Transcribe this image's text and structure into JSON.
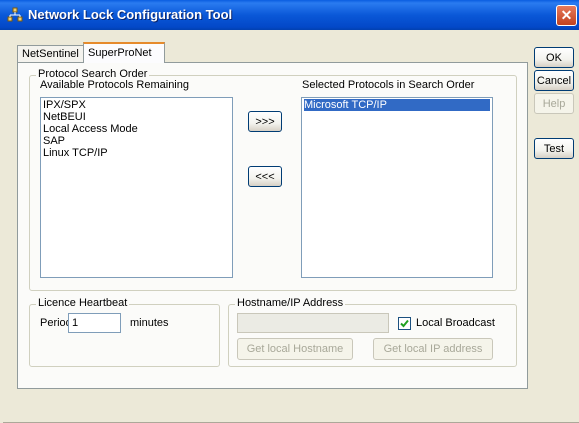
{
  "window": {
    "title": "Network Lock Configuration Tool",
    "close_glyph": "✕"
  },
  "tabs": [
    {
      "label": "NetSentinel",
      "active": false
    },
    {
      "label": "SuperProNet",
      "active": true
    }
  ],
  "protocol_group": {
    "legend": "Protocol Search Order",
    "available_label": "Available Protocols Remaining",
    "selected_label": "Selected Protocols in Search Order",
    "available": [
      "IPX/SPX",
      "NetBEUI",
      "Local Access Mode",
      "SAP",
      "Linux TCP/IP"
    ],
    "selected": [
      "Microsoft TCP/IP"
    ],
    "add_button": ">>>",
    "remove_button": "<<<"
  },
  "heartbeat_group": {
    "legend": "Licence Heartbeat",
    "period_label": "Period",
    "period_value": "1",
    "unit_label": "minutes"
  },
  "hostname_group": {
    "legend": "Hostname/IP Address",
    "hostname_value": "",
    "broadcast_label": "Local Broadcast",
    "broadcast_checked": true,
    "get_hostname_button": "Get local Hostname",
    "get_ip_button": "Get local IP address"
  },
  "side_buttons": {
    "ok": "OK",
    "cancel": "Cancel",
    "help": "Help",
    "test": "Test"
  },
  "colors": {
    "titlebar": "#0a58d8",
    "selection": "#316ac5",
    "tab_highlight": "#e68b2c"
  }
}
